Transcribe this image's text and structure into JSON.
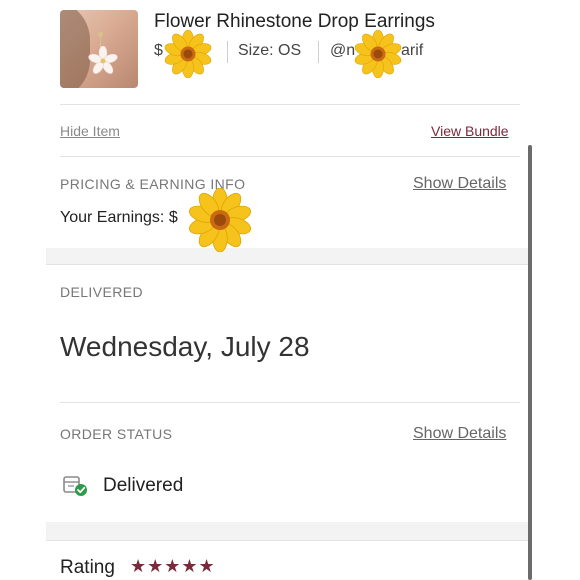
{
  "item": {
    "title": "Flower Rhinestone Drop Earrings",
    "price": "$",
    "size": "Size: OS",
    "seller": "@n",
    "seller_tail": "arif"
  },
  "actions": {
    "hide_item": "Hide Item",
    "view_bundle": "View Bundle"
  },
  "pricing": {
    "label": "PRICING & EARNING INFO",
    "show_details": "Show Details",
    "your_earnings": "Your Earnings: $"
  },
  "delivered": {
    "label": "DELIVERED",
    "date": "Wednesday, July 28"
  },
  "order_status": {
    "label": "ORDER STATUS",
    "show_details": "Show Details",
    "status": "Delivered"
  },
  "rating": {
    "label": "Rating",
    "stars": "★★★★★"
  },
  "colors": {
    "accent": "#7a2a3a",
    "status_green": "#2e9b4b",
    "sticker_petal": "#f6c21c",
    "sticker_center": "#c96a12"
  },
  "icons": {
    "status": "package-delivered-icon",
    "sticker": "sunflower-sticker"
  }
}
